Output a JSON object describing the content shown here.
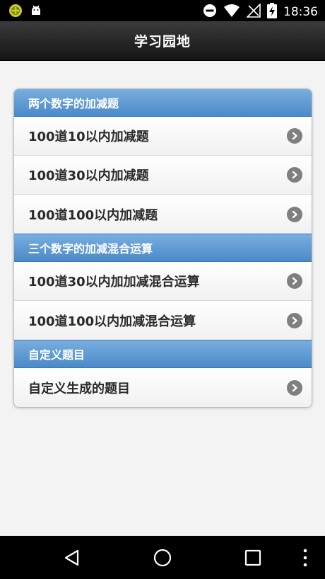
{
  "status_bar": {
    "time": "18:36",
    "icons": [
      "app-badge-icon",
      "android-icon",
      "do-not-disturb-icon",
      "wifi-icon",
      "signal-icon",
      "battery-charging-icon"
    ]
  },
  "header": {
    "title": "学习园地"
  },
  "sections": [
    {
      "title": "两个数字的加减题",
      "items": [
        {
          "label": "100道10以内加减题"
        },
        {
          "label": "100道30以内加减题"
        },
        {
          "label": "100道100以内加减题"
        }
      ]
    },
    {
      "title": "三个数字的加减混合运算",
      "items": [
        {
          "label": "100道30以内加加减混合运算"
        },
        {
          "label": "100道100以内加减混合运算"
        }
      ]
    },
    {
      "title": "自定义题目",
      "items": [
        {
          "label": "自定义生成的题目"
        }
      ]
    }
  ],
  "nav_bar": {
    "icons": [
      "back-icon",
      "home-icon",
      "recents-icon",
      "more-icon"
    ]
  },
  "colors": {
    "divider": "#4b8ac8",
    "header": "#1a1a1a",
    "arrow": "#7f7f7f"
  }
}
